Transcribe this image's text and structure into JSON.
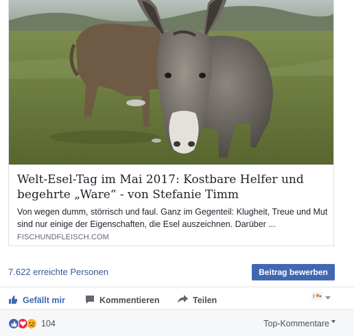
{
  "link_preview": {
    "image_icon": "donkey-photo",
    "title": "Welt-Esel-Tag im Mai 2017: Kostbare Helfer und begehrte „Ware“ - von Stefanie Timm",
    "description": "Von wegen dumm, störrisch und faul. Ganz im Gegenteil: Klugheit, Treue und Mut sind nur einige der Eigenschaften, die Esel auszeichnen. Darüber ...",
    "domain": "FISCHUNDFLEISCH.COM"
  },
  "insights": {
    "reach_text": "7.622 erreichte Personen",
    "promote_label": "Beitrag bewerben"
  },
  "actions": {
    "like_label": "Gefällt mir",
    "comment_label": "Kommentieren",
    "share_label": "Teilen",
    "reaction_picker_icon": "reaction-avatar-icon"
  },
  "footer": {
    "reaction_icons": [
      "like-icon",
      "love-icon",
      "sad-icon"
    ],
    "reaction_count": "104",
    "sort_label": "Top-Kommentare"
  },
  "colors": {
    "link_blue": "#365899",
    "button_blue": "#4267b2",
    "text_dark": "#1d2129",
    "text_gray": "#606770"
  }
}
